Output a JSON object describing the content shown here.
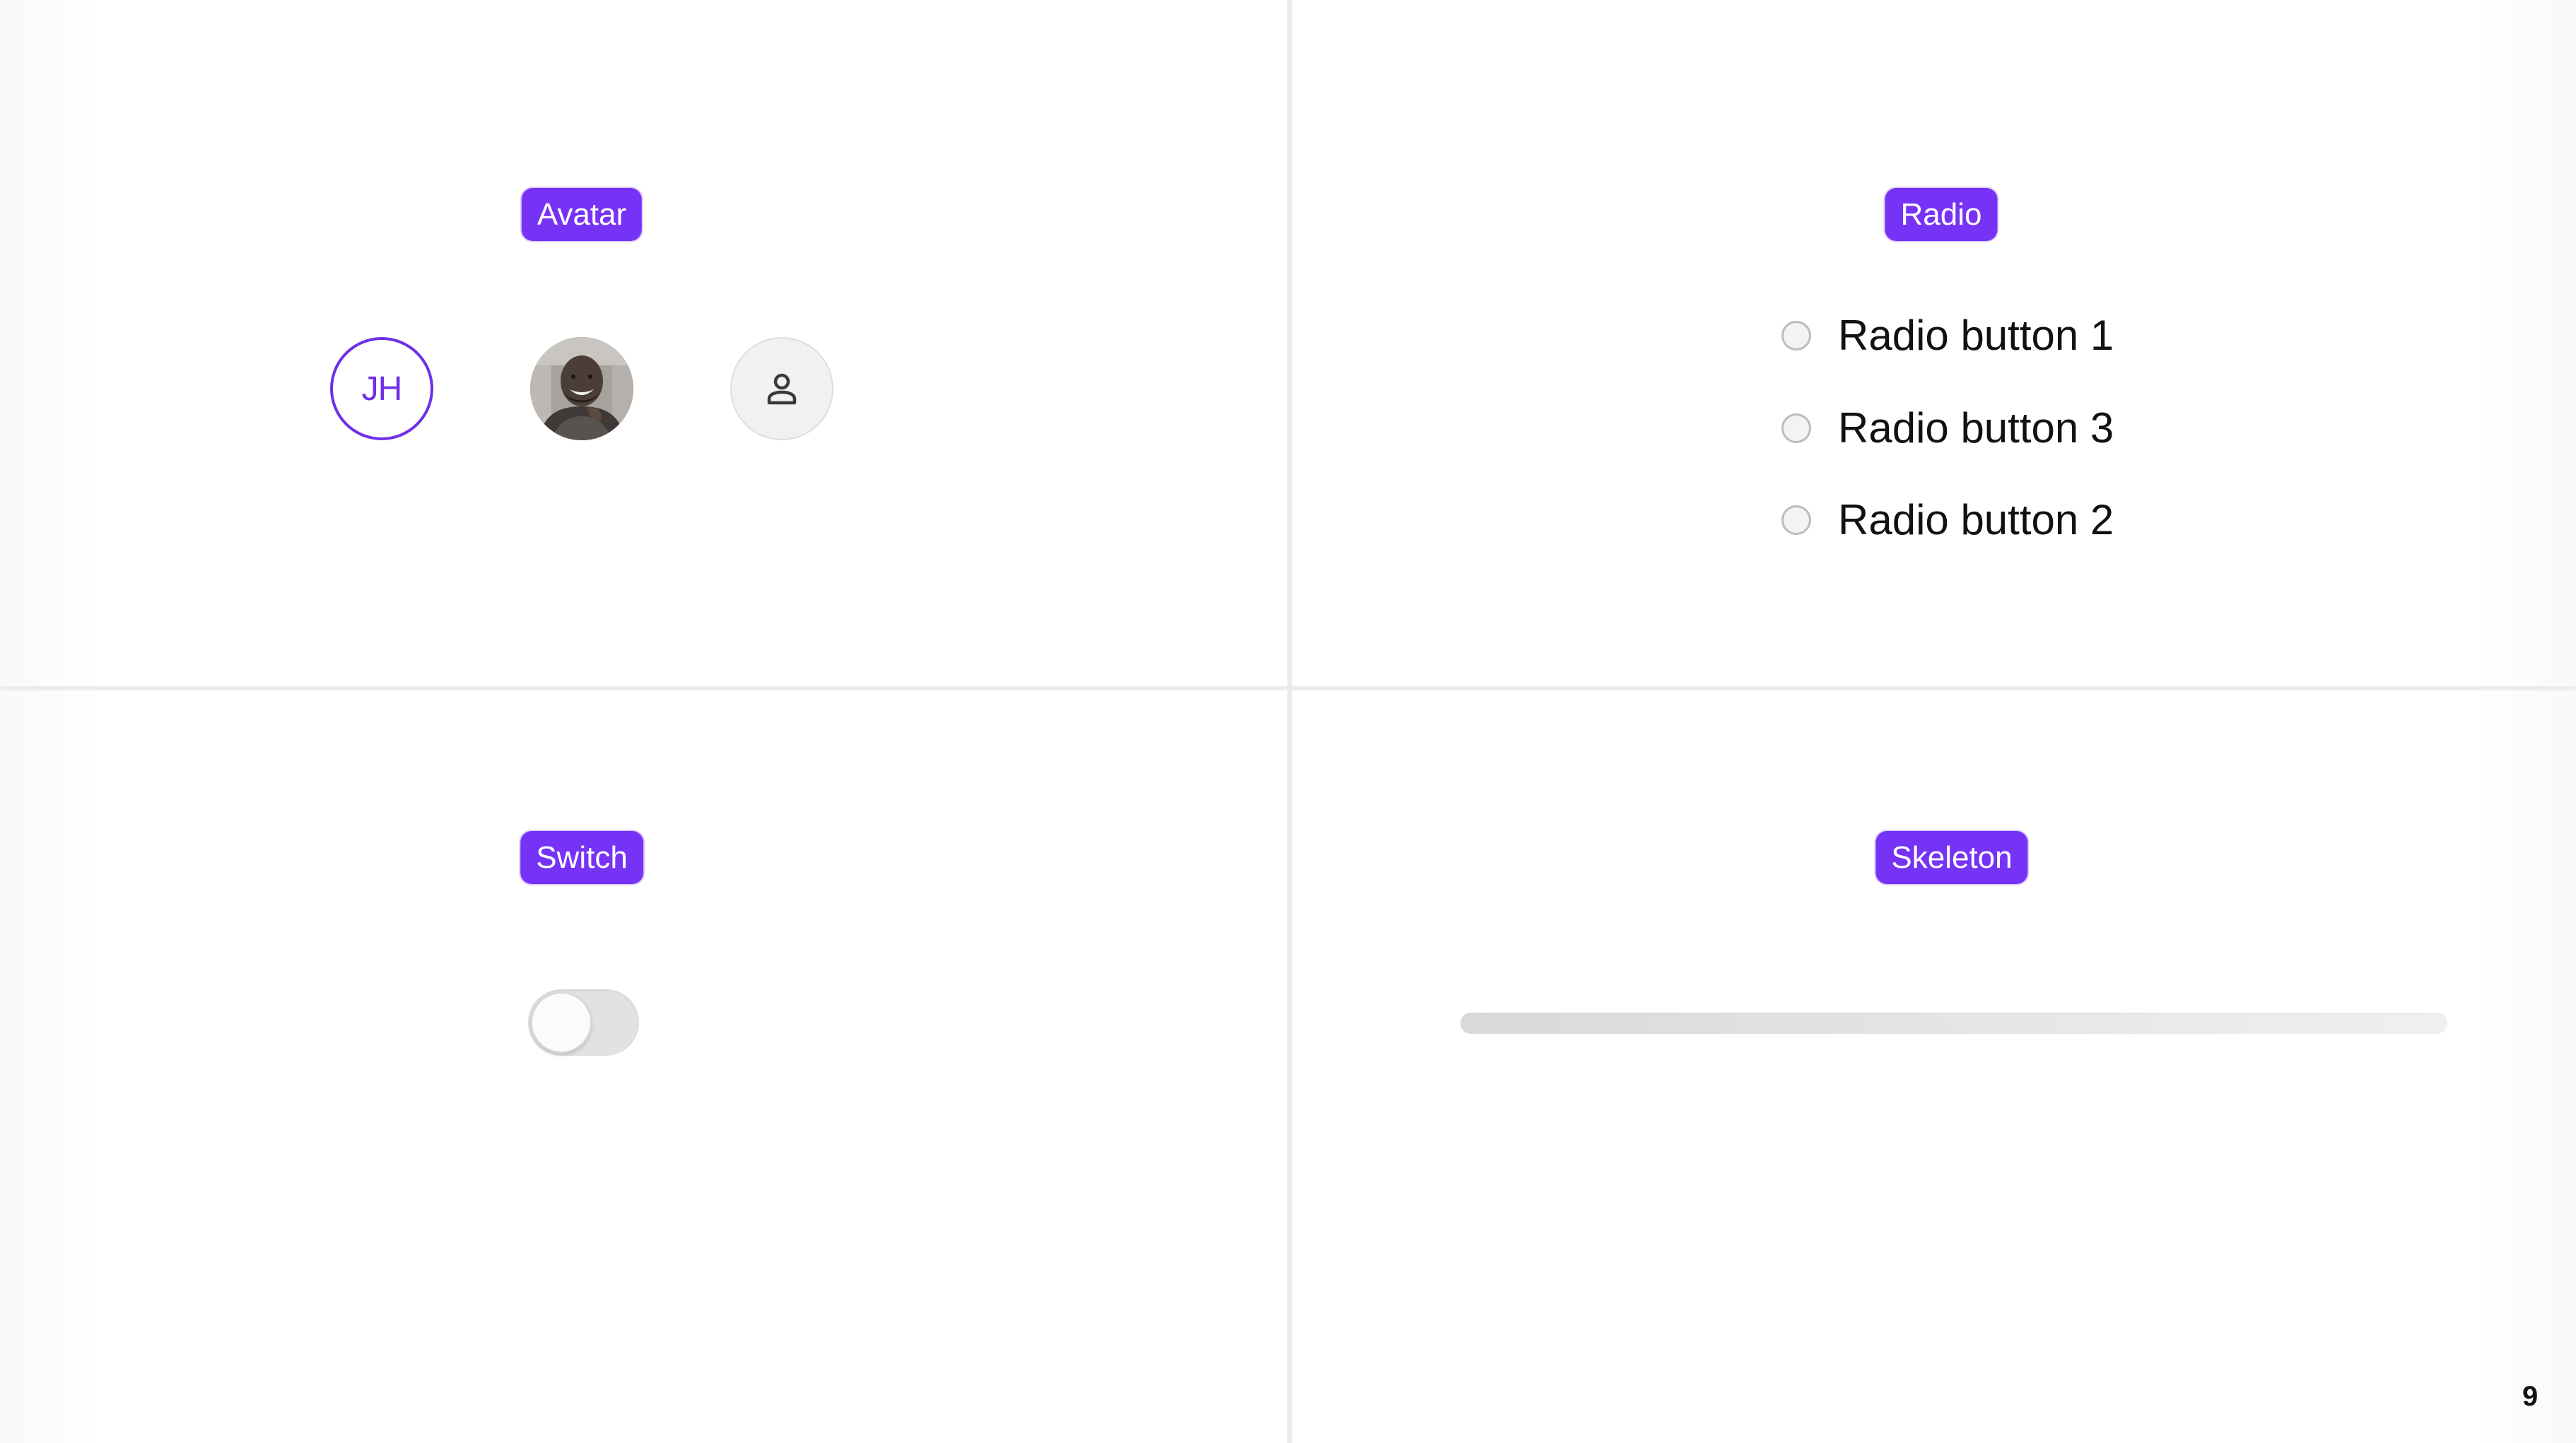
{
  "sections": {
    "avatar": {
      "label": "Avatar",
      "initials": "JH",
      "photo_icon": "person-photo",
      "placeholder_icon": "user-icon"
    },
    "radio": {
      "label": "Radio",
      "options": [
        {
          "label": "Radio button 1",
          "selected": false
        },
        {
          "label": "Radio button 3",
          "selected": false
        },
        {
          "label": "Radio button 2",
          "selected": false
        }
      ]
    },
    "switch": {
      "label": "Switch",
      "on": false
    },
    "skeleton": {
      "label": "Skeleton"
    }
  },
  "page_number": "9",
  "colors": {
    "accent": "#7633f5",
    "divider": "#ececec",
    "switch_track": "#e2e2e2",
    "skeleton": "#d9d9d9"
  }
}
